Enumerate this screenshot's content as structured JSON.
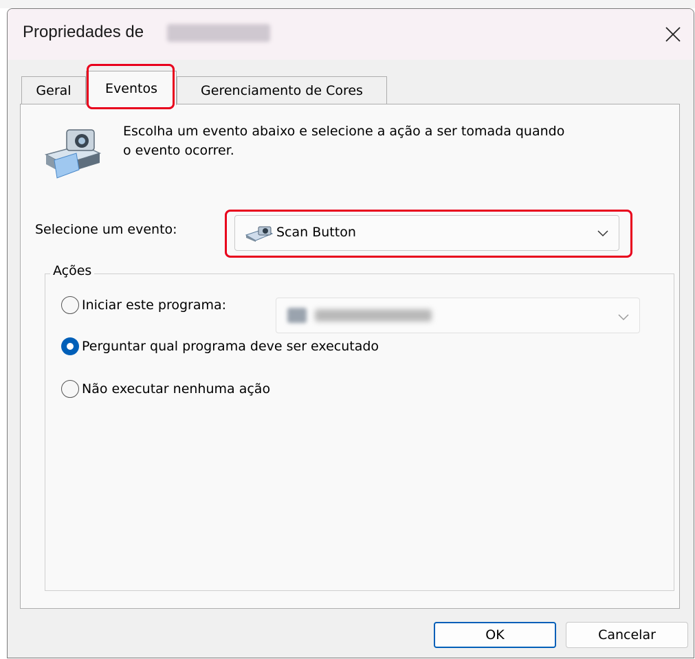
{
  "dialog": {
    "title": "Propriedades de",
    "close_icon": "close-icon"
  },
  "tabs": [
    {
      "label": "Geral",
      "selected": false
    },
    {
      "label": "Eventos",
      "selected": true
    },
    {
      "label": "Gerenciamento de Cores",
      "selected": false
    }
  ],
  "events": {
    "description": "Escolha um evento abaixo e selecione a ação a ser tomada quando\no evento ocorrer.",
    "select_label": "Selecione um evento:",
    "selected_event": "Scan Button",
    "event_icon": "scanner-icon"
  },
  "actions": {
    "group_label": "Ações",
    "options": [
      {
        "label": "Iniciar este programa:",
        "checked": false
      },
      {
        "label": "Perguntar qual programa deve ser executado",
        "checked": true
      },
      {
        "label": "Não executar nenhuma ação",
        "checked": false
      }
    ]
  },
  "buttons": {
    "ok": "OK",
    "cancel": "Cancelar"
  },
  "colors": {
    "highlight": "#e8001c",
    "accent": "#005fb8"
  }
}
